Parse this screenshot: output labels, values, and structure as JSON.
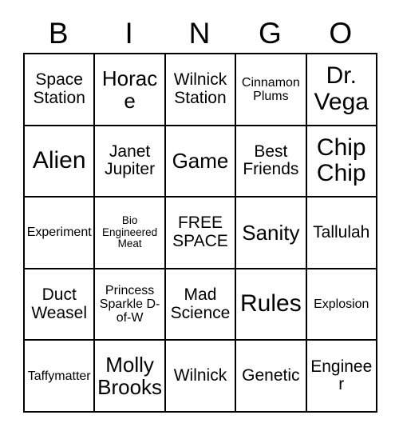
{
  "card": {
    "header_letters": [
      "B",
      "I",
      "N",
      "G",
      "O"
    ],
    "rows": [
      [
        {
          "text": "Space Station",
          "size": "md"
        },
        {
          "text": "Horace",
          "size": "lg"
        },
        {
          "text": "Wilnick Station",
          "size": "md"
        },
        {
          "text": "Cinnamon Plums",
          "size": "sm"
        },
        {
          "text": "Dr. Vega",
          "size": "xl"
        }
      ],
      [
        {
          "text": "Alien",
          "size": "xl"
        },
        {
          "text": "Janet Jupiter",
          "size": "md"
        },
        {
          "text": "Game",
          "size": "lg"
        },
        {
          "text": "Best Friends",
          "size": "md"
        },
        {
          "text": "Chip Chip",
          "size": "xl"
        }
      ],
      [
        {
          "text": "Experiment",
          "size": "sm"
        },
        {
          "text": "Bio Engineered Meat",
          "size": "xs"
        },
        {
          "text": "FREE SPACE",
          "size": "md"
        },
        {
          "text": "Sanity",
          "size": "lg"
        },
        {
          "text": "Tallulah",
          "size": "md"
        }
      ],
      [
        {
          "text": "Duct Weasel",
          "size": "md"
        },
        {
          "text": "Princess Sparkle D-of-W",
          "size": "sm"
        },
        {
          "text": "Mad Science",
          "size": "md"
        },
        {
          "text": "Rules",
          "size": "xl"
        },
        {
          "text": "Explosion",
          "size": "sm"
        }
      ],
      [
        {
          "text": "Taffymatter",
          "size": "sm"
        },
        {
          "text": "Molly Brooks",
          "size": "lg"
        },
        {
          "text": "Wilnick",
          "size": "md"
        },
        {
          "text": "Genetic",
          "size": "md"
        },
        {
          "text": "Engineer",
          "size": "md"
        }
      ]
    ]
  },
  "colors": {
    "border": "#000000",
    "text": "#000000",
    "background": "#ffffff"
  }
}
